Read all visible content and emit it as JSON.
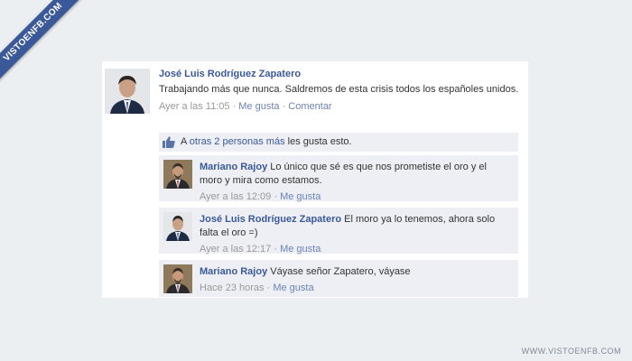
{
  "watermark": {
    "ribbon": "VISTOENFB.COM",
    "footer": "WWW.VISTOENFB.COM"
  },
  "post": {
    "author": "José Luis Rodríguez Zapatero",
    "text": "Trabajando más que nunca. Saldremos de esta crisis todos los españoles unidos.",
    "time": "Ayer a las 11:05",
    "sep1": " · ",
    "like": "Me gusta",
    "sep2": " · ",
    "comment": "Comentar"
  },
  "likes": {
    "prefix": "A ",
    "link": "otras 2 personas más",
    "suffix": " les gusta esto."
  },
  "comments": [
    {
      "author": "Mariano Rajoy",
      "text": " Lo único que sé es que nos prometiste el oro y el moro y mira como estamos.",
      "time": "Ayer a las 12:09",
      "sep": " · ",
      "like": "Me gusta"
    },
    {
      "author": "José Luis Rodríguez Zapatero",
      "text": " El moro ya lo tenemos, ahora solo falta el oro =)",
      "time": "Ayer a las 12:17",
      "sep": " · ",
      "like": "Me gusta"
    },
    {
      "author": "Mariano Rajoy",
      "text": " Váyase señor Zapatero, váyase",
      "time": "Hace 23 horas",
      "sep": " · ",
      "like": "Me gusta"
    }
  ],
  "colors": {
    "link": "#3b5998",
    "meta": "#999999",
    "comment_bg": "#edeff4",
    "ribbon": "#3b5998"
  }
}
